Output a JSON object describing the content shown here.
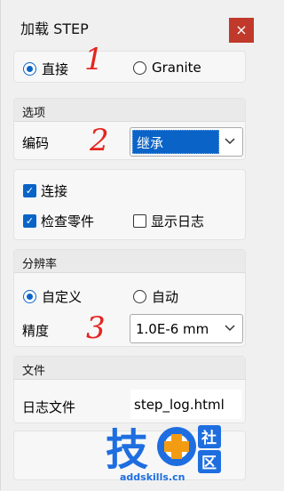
{
  "window": {
    "title": "加载 STEP",
    "close_label": "×"
  },
  "source": {
    "options": [
      {
        "label": "直接",
        "selected": true
      },
      {
        "label": "Granite",
        "selected": false
      }
    ]
  },
  "options_section": {
    "header": "选项",
    "encoding_label": "编码",
    "encoding_value": "继承"
  },
  "checks": {
    "connect": {
      "label": "连接",
      "checked": true
    },
    "check_parts": {
      "label": "检查零件",
      "checked": true
    },
    "show_log": {
      "label": "显示日志",
      "checked": false
    }
  },
  "resolution": {
    "header": "分辨率",
    "options": [
      {
        "label": "自定义",
        "selected": true
      },
      {
        "label": "自动",
        "selected": false
      }
    ],
    "precision_label": "精度",
    "precision_value": "1.0E-6 mm"
  },
  "file_section": {
    "header": "文件",
    "log_label": "日志文件",
    "log_value": "step_log.html"
  },
  "annotations": [
    "1",
    "2",
    "3"
  ],
  "watermark": {
    "glyph": "技",
    "badge_1": "社",
    "badge_2": "区",
    "url": "addskills.cn"
  },
  "colors": {
    "accent": "#0a64c8",
    "close": "#c0392b",
    "annotation": "#e52520",
    "watermark": "#1e6ee0",
    "watermark_orange": "#f39c12"
  }
}
